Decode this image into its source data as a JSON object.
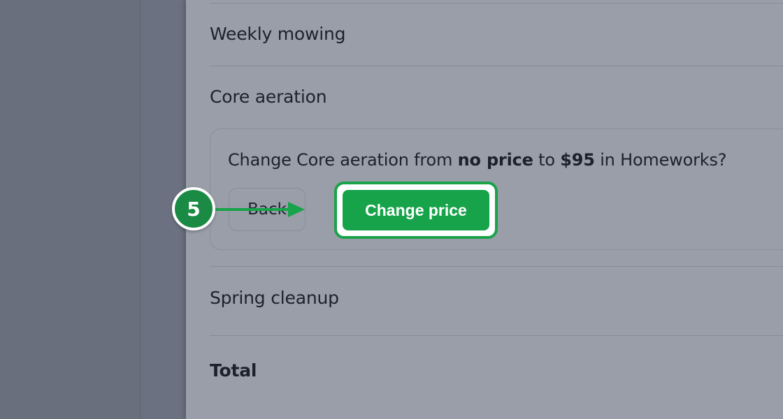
{
  "rows": [
    {
      "label": "Weekly mowing"
    },
    {
      "label": "Core aeration"
    },
    {
      "label": "Spring cleanup"
    }
  ],
  "total_label": "Total",
  "confirm": {
    "prefix": "Change Core aeration from ",
    "from": "no price",
    "middle": " to ",
    "to": "$95",
    "suffix": " in Homeworks?",
    "back_label": "Back",
    "change_label": "Change price"
  },
  "annotation": {
    "step": "5",
    "color": "#16a34a"
  },
  "colors": {
    "accent": "#16a34a",
    "panel": "#9a9ea8",
    "backdrop": "#6b7180"
  }
}
